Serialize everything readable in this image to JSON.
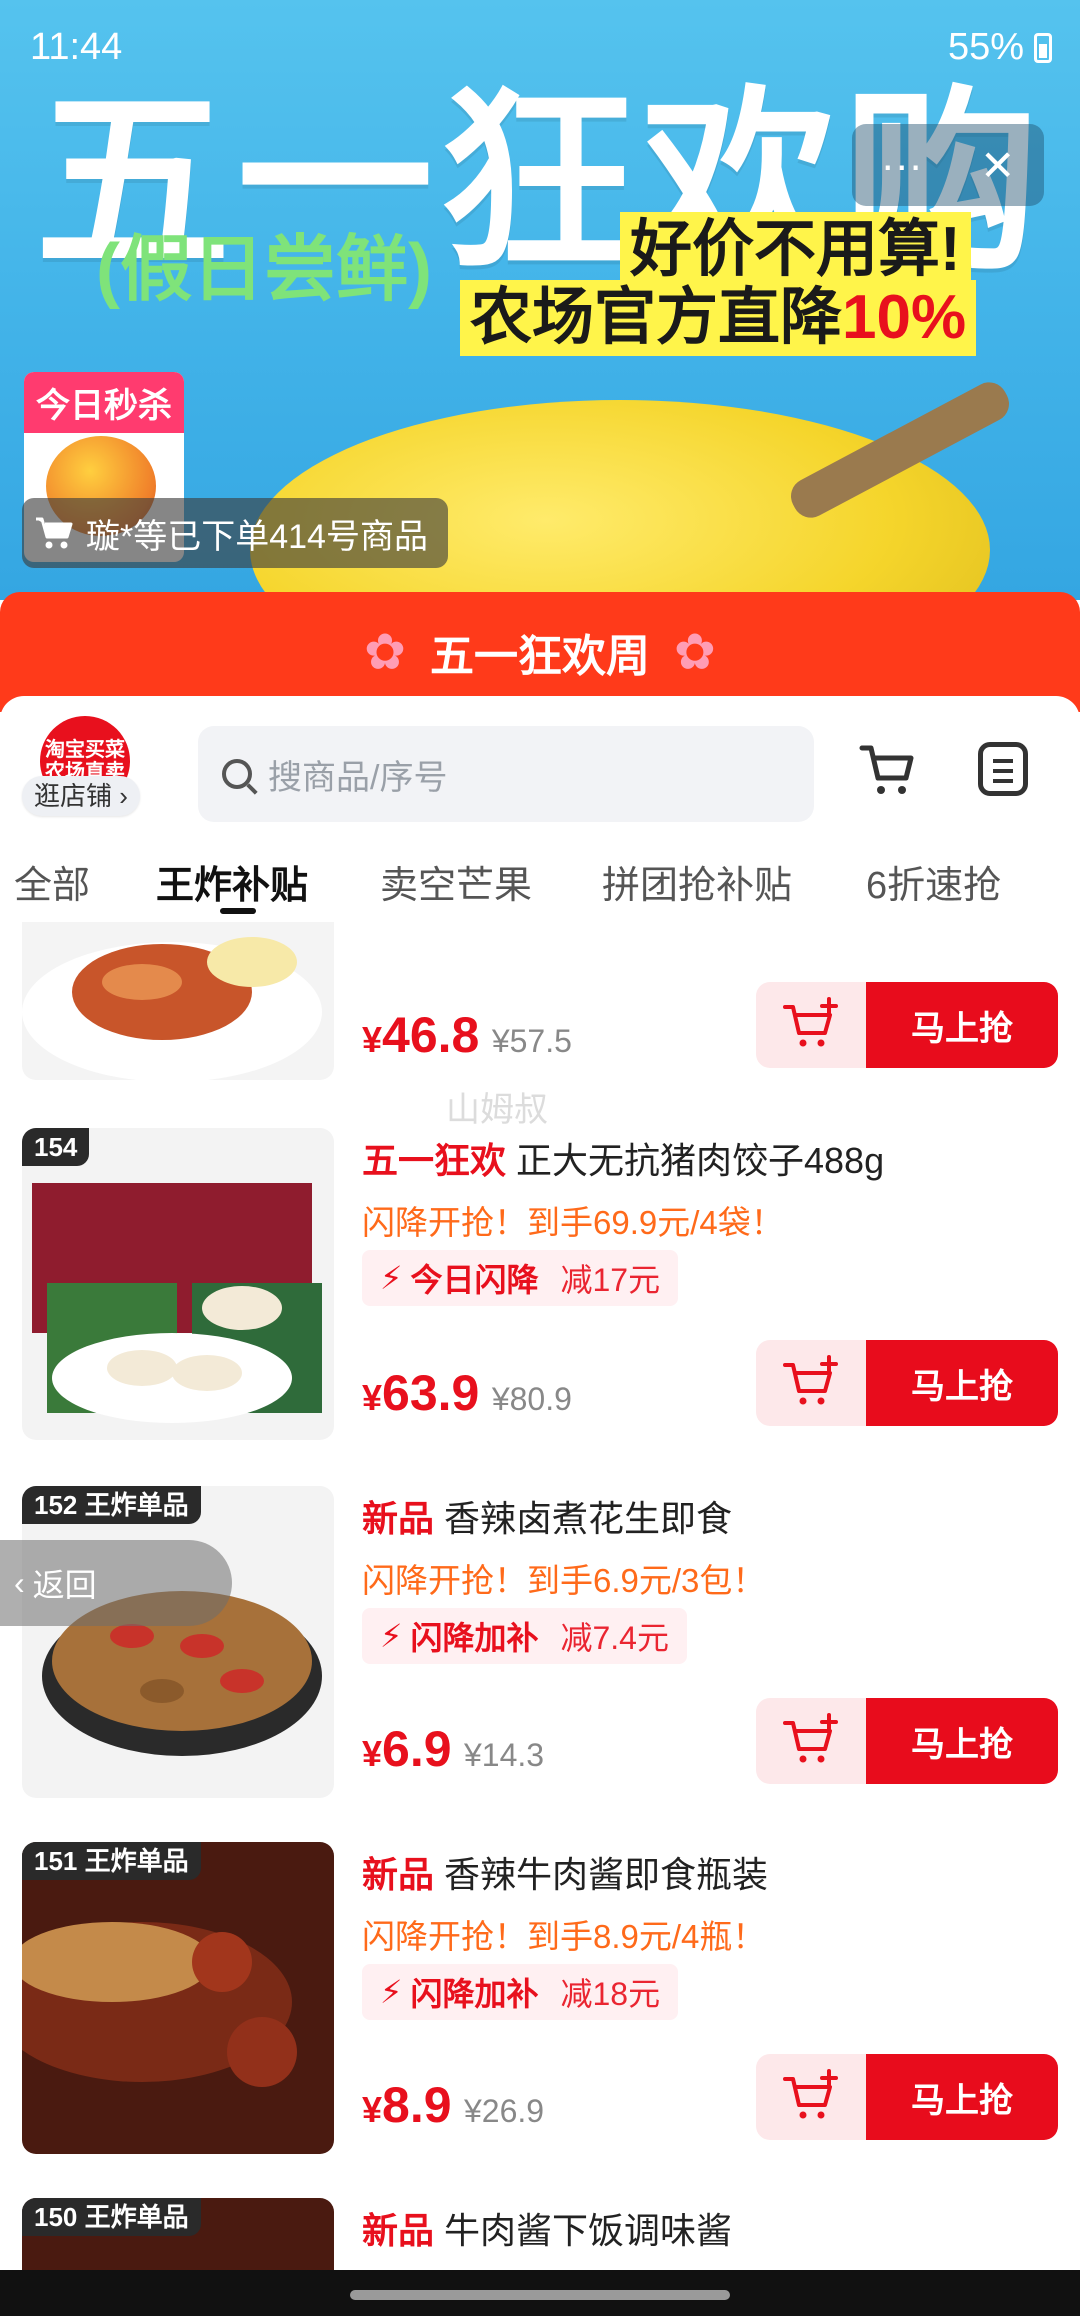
{
  "status_bar": {
    "time": "11:44",
    "battery": "55%"
  },
  "hero": {
    "title": "五一狂欢购",
    "subtitle": "(假日尝鲜)",
    "slogan_line1": "好价不用算!",
    "slogan_line2_prefix": "农场官方直降",
    "slogan_line2_pct": "10%",
    "mango_badge": "今日秒杀",
    "order_toast": "璇*等已下单414号商品"
  },
  "banner": {
    "title": "五一狂欢周"
  },
  "shop": {
    "logo_line1": "淘宝买菜",
    "logo_line2": "农场直卖",
    "visit_label": "逛店铺 ›",
    "search_placeholder": "搜商品/序号"
  },
  "tabs": [
    {
      "label": "全部"
    },
    {
      "label": "王炸补贴"
    },
    {
      "label": "卖空芒果"
    },
    {
      "label": "拼团抢补贴"
    },
    {
      "label": "6折速抢"
    }
  ],
  "watermark": "山姆叔",
  "back_label": "返回",
  "products": [
    {
      "rank": "",
      "tag": "",
      "name": "",
      "promo": "",
      "badge_name": "",
      "badge_value": "",
      "price_currency": "¥",
      "price": "46.8",
      "orig_price": "¥57.5",
      "buy_label": "马上抢"
    },
    {
      "rank": "154",
      "tag": "五一狂欢",
      "name": "正大无抗猪肉饺子488g",
      "promo": "闪降开抢！到手69.9元/4袋！",
      "badge_name": "今日闪降",
      "badge_value": "减17元",
      "price_currency": "¥",
      "price": "63.9",
      "orig_price": "¥80.9",
      "buy_label": "马上抢"
    },
    {
      "rank": "152 王炸单品",
      "tag": "新品",
      "name": "香辣卤煮花生即食",
      "promo": "闪降开抢！到手6.9元/3包！",
      "badge_name": "闪降加补",
      "badge_value": "减7.4元",
      "price_currency": "¥",
      "price": "6.9",
      "orig_price": "¥14.3",
      "buy_label": "马上抢"
    },
    {
      "rank": "151 王炸单品",
      "tag": "新品",
      "name": "香辣牛肉酱即食瓶装",
      "promo": "闪降开抢！到手8.9元/4瓶！",
      "badge_name": "闪降加补",
      "badge_value": "减18元",
      "price_currency": "¥",
      "price": "8.9",
      "orig_price": "¥26.9",
      "buy_label": "马上抢"
    },
    {
      "rank": "150 王炸单品",
      "tag": "新品",
      "name": "牛肉酱下饭调味酱"
    }
  ]
}
